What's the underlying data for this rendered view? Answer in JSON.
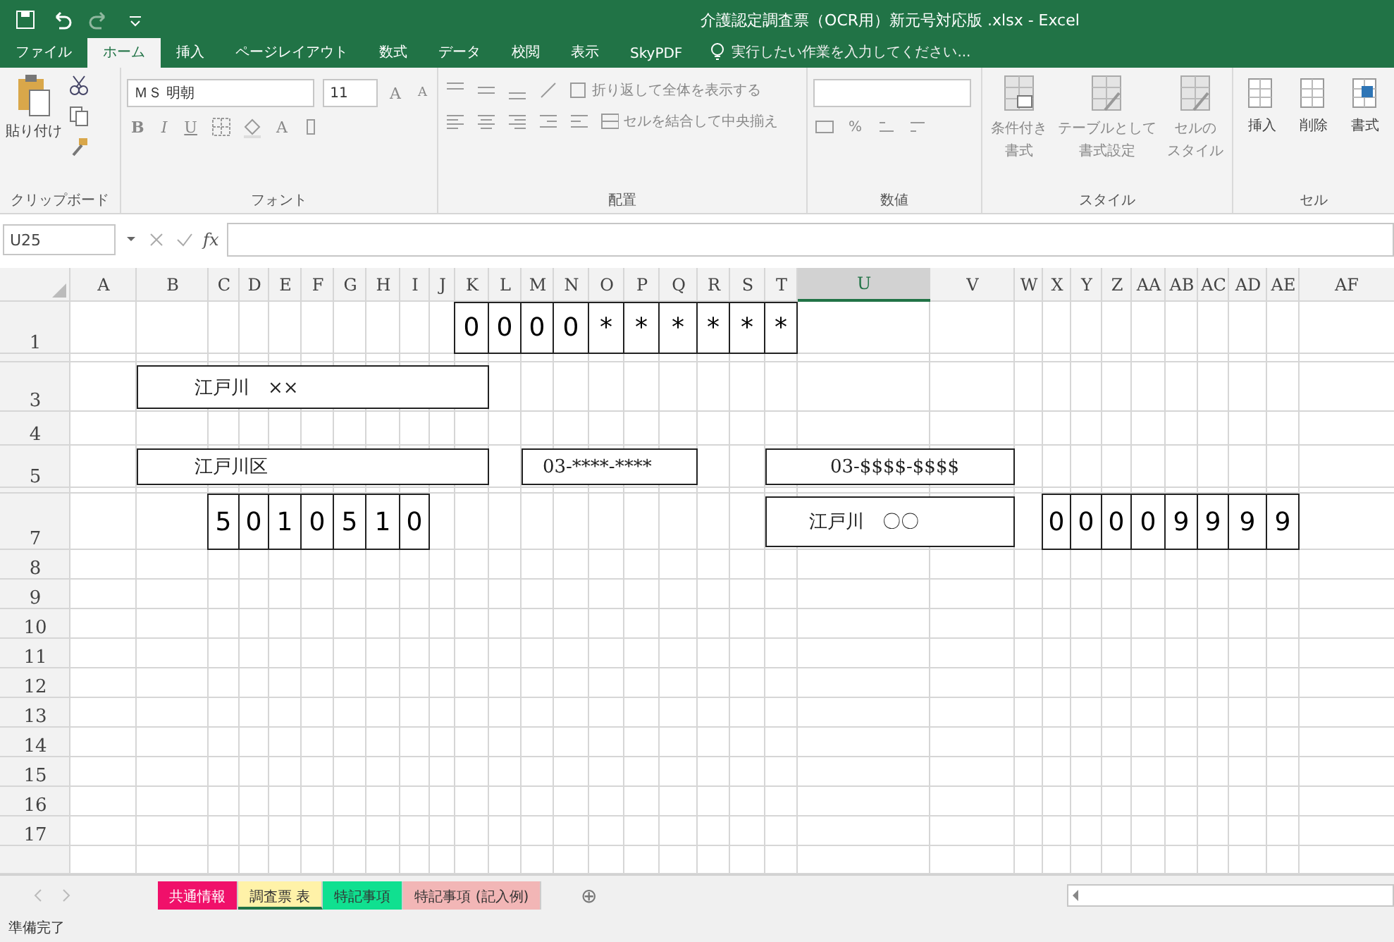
{
  "title_bar": {
    "title": "介護認定調査票（OCR用）新元号対応版 .xlsx - Excel"
  },
  "menu_tabs": [
    {
      "label": "ファイル",
      "selected": false
    },
    {
      "label": "ホーム",
      "selected": true
    },
    {
      "label": "挿入",
      "selected": false
    },
    {
      "label": "ページレイアウト",
      "selected": false
    },
    {
      "label": "数式",
      "selected": false
    },
    {
      "label": "データ",
      "selected": false
    },
    {
      "label": "校閲",
      "selected": false
    },
    {
      "label": "表示",
      "selected": false
    },
    {
      "label": "SkyPDF",
      "selected": false
    }
  ],
  "tell_me": {
    "placeholder": "実行したい作業を入力してください..."
  },
  "ribbon": {
    "clipboard": {
      "label": "クリップボード",
      "paste": "貼り付け"
    },
    "font": {
      "label": "フォント",
      "font_name": "ＭＳ 明朝",
      "font_size": "11",
      "grow": "A",
      "shrink": "A",
      "format_buttons": [
        "B",
        "I",
        "U"
      ],
      "font_color": "A"
    },
    "alignment": {
      "label": "配置",
      "wrap_text": "折り返して全体を表示する",
      "merge_center": "セルを結合して中央揃え"
    },
    "number": {
      "label": "数値",
      "percent": "%"
    },
    "styles": {
      "label": "スタイル",
      "buttons": [
        {
          "lines": [
            "条件付き",
            "書式"
          ]
        },
        {
          "lines": [
            "テーブルとして",
            "書式設定"
          ]
        },
        {
          "lines": [
            "セルの",
            "スタイル"
          ]
        }
      ]
    },
    "cells": {
      "label": "セル",
      "buttons": [
        "挿入",
        "削除",
        "書式"
      ]
    }
  },
  "formula_bar": {
    "name_box": "U25",
    "function_label": "fx"
  },
  "sheet": {
    "columns": [
      {
        "label": "A",
        "selected": false
      },
      {
        "label": "B",
        "selected": false
      },
      {
        "label": "C",
        "selected": false
      },
      {
        "label": "D",
        "selected": false
      },
      {
        "label": "E",
        "selected": false
      },
      {
        "label": "F",
        "selected": false
      },
      {
        "label": "G",
        "selected": false
      },
      {
        "label": "H",
        "selected": false
      },
      {
        "label": "I",
        "selected": false
      },
      {
        "label": "J",
        "selected": false
      },
      {
        "label": "K",
        "selected": false
      },
      {
        "label": "L",
        "selected": false
      },
      {
        "label": "M",
        "selected": false
      },
      {
        "label": "N",
        "selected": false
      },
      {
        "label": "O",
        "selected": false
      },
      {
        "label": "P",
        "selected": false
      },
      {
        "label": "Q",
        "selected": false
      },
      {
        "label": "R",
        "selected": false
      },
      {
        "label": "S",
        "selected": false
      },
      {
        "label": "T",
        "selected": false
      },
      {
        "label": "U",
        "selected": true
      },
      {
        "label": "V",
        "selected": false
      },
      {
        "label": "W",
        "selected": false
      },
      {
        "label": "X",
        "selected": false
      },
      {
        "label": "Y",
        "selected": false
      },
      {
        "label": "Z",
        "selected": false
      },
      {
        "label": "AA",
        "selected": false
      },
      {
        "label": "AB",
        "selected": false
      },
      {
        "label": "AC",
        "selected": false
      },
      {
        "label": "AD",
        "selected": false
      },
      {
        "label": "AE",
        "selected": false
      },
      {
        "label": "AF",
        "selected": false
      }
    ],
    "rows": [
      "1",
      "3",
      "4",
      "5",
      "7",
      "8",
      "9",
      "10",
      "11",
      "12",
      "13",
      "14",
      "15",
      "16",
      "17"
    ],
    "boxes": [
      {
        "kind": "digits",
        "digits": [
          "0",
          "0",
          "0",
          "0",
          "*",
          "*",
          "*",
          "*",
          "*",
          "*"
        ]
      },
      {
        "kind": "field",
        "text": "江戸川　××"
      },
      {
        "kind": "field",
        "text": "江戸川区"
      },
      {
        "kind": "field",
        "text": "03-****-****"
      },
      {
        "kind": "field",
        "text": "03-$$$$-$$$$"
      },
      {
        "kind": "digits",
        "digits": [
          "5",
          "0",
          "1",
          "0",
          "5",
          "1",
          "0"
        ]
      },
      {
        "kind": "field",
        "text": "江戸川　〇〇"
      },
      {
        "kind": "digits",
        "digits": [
          "0",
          "0",
          "0",
          "0",
          "9",
          "9",
          "9",
          "9"
        ]
      }
    ]
  },
  "sheet_tabs": [
    {
      "label": "共通情報",
      "selected": false,
      "color": "#f0106a"
    },
    {
      "label": "調査票 表",
      "selected": true,
      "color": "#fff2a8"
    },
    {
      "label": "特記事項",
      "selected": false,
      "color": "#10e090"
    },
    {
      "label": "特記事項 (記入例)",
      "selected": false,
      "color": "#f2b6b6"
    }
  ],
  "add_sheet": "⊕",
  "status_bar": {
    "text": "準備完了"
  }
}
